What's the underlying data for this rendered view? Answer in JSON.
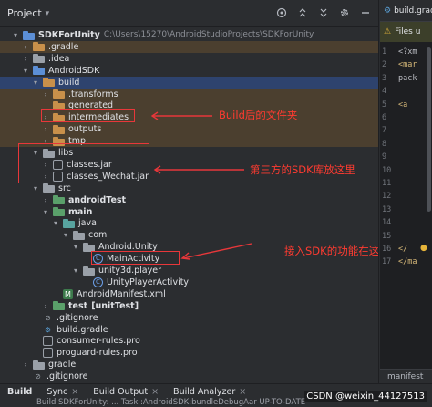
{
  "panel": {
    "title": "Project",
    "chevron": "▾",
    "icons": [
      "target-icon",
      "collapse-icon",
      "expand-icon",
      "gear-icon",
      "minimize-icon"
    ]
  },
  "tree": [
    {
      "depth": 0,
      "arrow": "▾",
      "icon": "folder-blue",
      "label": "SDKForUnity",
      "bold": true,
      "path": "C:\\Users\\15270\\AndroidStudioProjects\\SDKForUnity",
      "hl": ""
    },
    {
      "depth": 1,
      "arrow": "›",
      "icon": "folder-orange",
      "label": ".gradle",
      "hl": "brown"
    },
    {
      "depth": 1,
      "arrow": "›",
      "icon": "folder-gray",
      "label": ".idea",
      "hl": ""
    },
    {
      "depth": 1,
      "arrow": "▾",
      "icon": "folder-blue",
      "label": "AndroidSDK",
      "hl": ""
    },
    {
      "depth": 2,
      "arrow": "▾",
      "icon": "folder-orange",
      "label": "build",
      "hl": "selected"
    },
    {
      "depth": 3,
      "arrow": "›",
      "icon": "folder-orange",
      "label": ".transforms",
      "hl": "brown"
    },
    {
      "depth": 3,
      "arrow": "",
      "icon": "folder-orange",
      "label": "generated",
      "hl": "brown"
    },
    {
      "depth": 3,
      "arrow": "›",
      "icon": "folder-orange",
      "label": "intermediates",
      "hl": "brown"
    },
    {
      "depth": 3,
      "arrow": "›",
      "icon": "folder-orange",
      "label": "outputs",
      "hl": "brown"
    },
    {
      "depth": 3,
      "arrow": "›",
      "icon": "folder-orange",
      "label": "tmp",
      "hl": "brown"
    },
    {
      "depth": 2,
      "arrow": "▾",
      "icon": "folder-lib",
      "label": "libs",
      "hl": ""
    },
    {
      "depth": 3,
      "arrow": "›",
      "icon": "jar",
      "label": "classes.jar",
      "hl": ""
    },
    {
      "depth": 3,
      "arrow": "›",
      "icon": "jar",
      "label": "classes_Wechat.jar",
      "hl": ""
    },
    {
      "depth": 2,
      "arrow": "▾",
      "icon": "folder-gray",
      "label": "src",
      "hl": ""
    },
    {
      "depth": 3,
      "arrow": "›",
      "icon": "folder-green",
      "label": "androidTest",
      "bold": true,
      "hl": ""
    },
    {
      "depth": 3,
      "arrow": "▾",
      "icon": "folder-green",
      "label": "main",
      "bold": true,
      "hl": ""
    },
    {
      "depth": 4,
      "arrow": "▾",
      "icon": "folder-teal",
      "label": "java",
      "hl": ""
    },
    {
      "depth": 5,
      "arrow": "▾",
      "icon": "folder-gray",
      "label": "com",
      "hl": ""
    },
    {
      "depth": 6,
      "arrow": "▾",
      "icon": "folder-gray",
      "label": "Android.Unity",
      "hl": ""
    },
    {
      "depth": 7,
      "arrow": "",
      "icon": "class",
      "label": "MainActivity",
      "hl": ""
    },
    {
      "depth": 6,
      "arrow": "▾",
      "icon": "folder-gray",
      "label": "unity3d.player",
      "hl": ""
    },
    {
      "depth": 7,
      "arrow": "",
      "icon": "class",
      "label": "UnityPlayerActivity",
      "hl": ""
    },
    {
      "depth": 4,
      "arrow": "",
      "icon": "manifest",
      "label": "AndroidManifest.xml",
      "hl": ""
    },
    {
      "depth": 3,
      "arrow": "›",
      "icon": "folder-green",
      "label": "test",
      "bold": true,
      "suffix": "[unitTest]",
      "hl": ""
    },
    {
      "depth": 2,
      "arrow": "",
      "icon": "gitignore",
      "label": ".gitignore",
      "hl": ""
    },
    {
      "depth": 2,
      "arrow": "",
      "icon": "gradle",
      "label": "build.gradle",
      "hl": ""
    },
    {
      "depth": 2,
      "arrow": "",
      "icon": "text",
      "label": "consumer-rules.pro",
      "hl": ""
    },
    {
      "depth": 2,
      "arrow": "",
      "icon": "text",
      "label": "proguard-rules.pro",
      "hl": ""
    },
    {
      "depth": 1,
      "arrow": "›",
      "icon": "folder-gray",
      "label": "gradle",
      "hl": ""
    },
    {
      "depth": 1,
      "arrow": "",
      "icon": "gitignore",
      "label": ".gitignore",
      "hl": ""
    }
  ],
  "annotations": {
    "build": "Build后的文件夹",
    "libs": "第三方的SDK库放这里",
    "main_activity": "接入SDK的功能在这写",
    "color": "#ff3b30"
  },
  "editor": {
    "tab": "build.grad",
    "banner": "Files u",
    "lines": [
      {
        "text": "<?xm",
        "color": "#bcbec4"
      },
      {
        "text": "<mar",
        "color": "#d5b778"
      },
      {
        "text": "pack",
        "color": "#bcbec4"
      },
      {
        "text": "",
        "color": "#bcbec4"
      },
      {
        "text": "<a",
        "color": "#d5b778"
      },
      {
        "text": "",
        "color": "#bcbec4"
      },
      {
        "text": "",
        "color": "#bcbec4"
      },
      {
        "text": "",
        "color": "#bcbec4"
      },
      {
        "text": "",
        "color": "#bcbec4"
      },
      {
        "text": "",
        "color": "#bcbec4"
      },
      {
        "text": "",
        "color": "#bcbec4"
      },
      {
        "text": "",
        "color": "#bcbec4"
      },
      {
        "text": "",
        "color": "#bcbec4"
      },
      {
        "text": "",
        "color": "#bcbec4"
      },
      {
        "text": "",
        "color": "#bcbec4"
      },
      {
        "text": "</",
        "color": "#d5b778"
      },
      {
        "text": "</ma",
        "color": "#d5b778"
      }
    ],
    "line_numbers": [
      "1",
      "2",
      "3",
      "4",
      "5",
      "6",
      "7",
      "8",
      "9",
      "10",
      "11",
      "12",
      "13",
      "14",
      "15",
      "16",
      "17"
    ],
    "footer": "manifest"
  },
  "bottom": {
    "tabs": [
      {
        "label": "Build",
        "bold": true
      },
      {
        "label": "Sync",
        "close": true
      },
      {
        "label": "Build Output",
        "close": true
      },
      {
        "label": "Build Analyzer",
        "close": true
      }
    ],
    "status": "Build SDKForUnity: ...   Task :AndroidSDK:bundleDebugAar UP-TO-DATE",
    "watermark": "CSDN @weixin_44127513"
  }
}
